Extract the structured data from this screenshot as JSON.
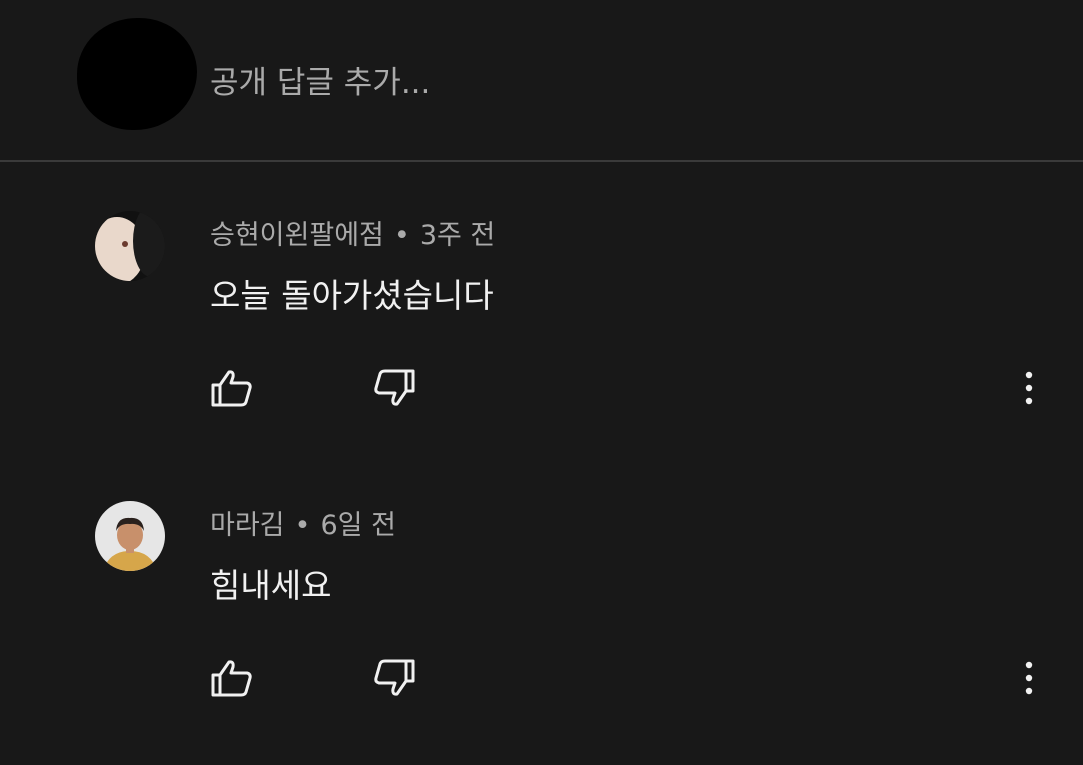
{
  "reply": {
    "placeholder": "공개 답글 추가..."
  },
  "comments": [
    {
      "author": "승현이왼팔에점",
      "separator": "•",
      "time": "3주 전",
      "text": "오늘 돌아가셨습니다"
    },
    {
      "author": "마라김",
      "separator": "•",
      "time": "6일 전",
      "text": "힘내세요"
    }
  ],
  "icons": {
    "like": "thumbs-up-icon",
    "dislike": "thumbs-down-icon",
    "more": "more-vertical-icon"
  },
  "colors": {
    "background": "#181818",
    "primary_text": "#f1f1f1",
    "secondary_text": "#aaaaaa",
    "divider": "#3a3a3a"
  }
}
